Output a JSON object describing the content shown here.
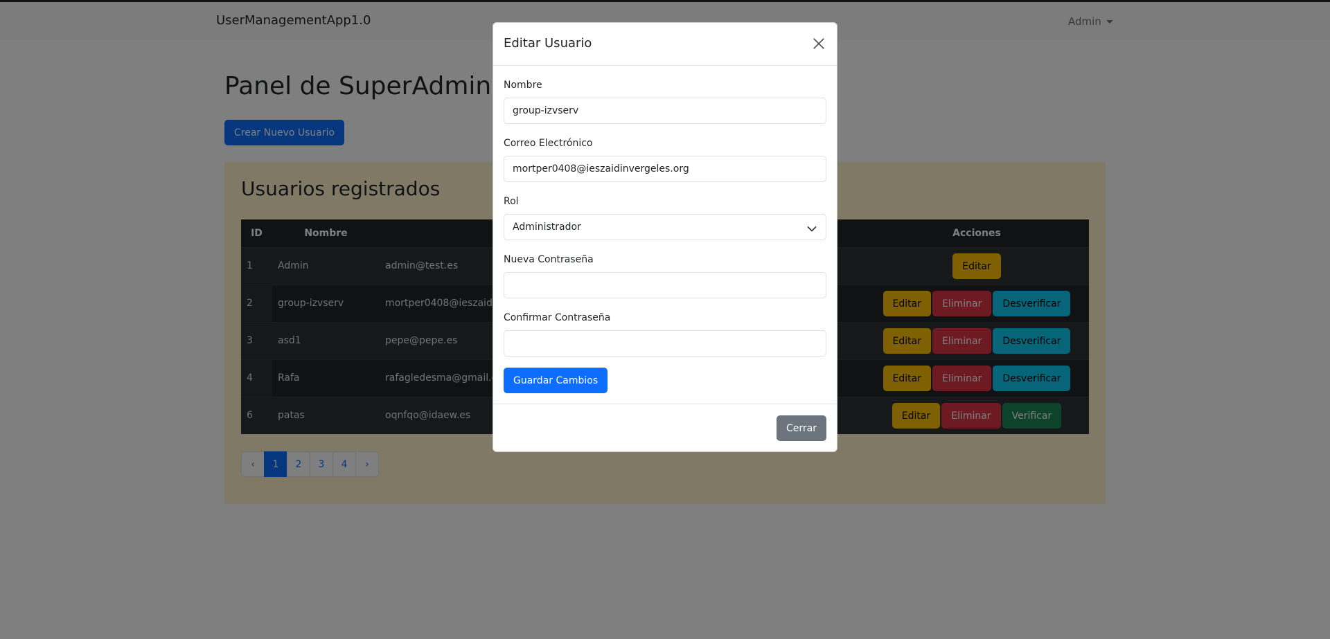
{
  "navbar": {
    "brand": "UserManagementApp1.0",
    "user_menu": "Admin"
  },
  "main": {
    "title": "Panel de SuperAdmin",
    "create_button": "Crear Nuevo Usuario",
    "card_title": "Usuarios registrados",
    "table": {
      "headers": {
        "id": "ID",
        "name": "Nombre",
        "email": "",
        "actions": "Acciones"
      },
      "rows": [
        {
          "id": "1",
          "name": "Admin",
          "email": "admin@test.es",
          "actions": [
            "Editar"
          ]
        },
        {
          "id": "2",
          "name": "group-izvserv",
          "email": "mortper0408@ieszaidin",
          "actions": [
            "Editar",
            "Eliminar",
            "Desverificar"
          ]
        },
        {
          "id": "3",
          "name": "asd1",
          "email": "pepe@pepe.es",
          "actions": [
            "Editar",
            "Eliminar",
            "Desverificar"
          ]
        },
        {
          "id": "4",
          "name": "Rafa",
          "email": "rafagledesma@gmail.co",
          "actions": [
            "Editar",
            "Eliminar",
            "Desverificar"
          ]
        },
        {
          "id": "6",
          "name": "patas",
          "email": "oqnfqo@idaew.es",
          "actions": [
            "Editar",
            "Eliminar",
            "Verificar"
          ]
        }
      ]
    },
    "pagination": {
      "prev": "‹",
      "pages": [
        "1",
        "2",
        "3",
        "4"
      ],
      "next": "›",
      "current": "1"
    }
  },
  "modal": {
    "title": "Editar Usuario",
    "fields": {
      "name": {
        "label": "Nombre",
        "value": "group-izvserv"
      },
      "email": {
        "label": "Correo Electrónico",
        "value": "mortper0408@ieszaidinvergeles.org"
      },
      "role": {
        "label": "Rol",
        "value": "Administrador"
      },
      "new_password": {
        "label": "Nueva Contraseña",
        "value": ""
      },
      "confirm_password": {
        "label": "Confirmar Contraseña",
        "value": ""
      }
    },
    "save_button": "Guardar Cambios",
    "close_button": "Cerrar"
  },
  "colors": {
    "primary": "#0d6efd",
    "warning": "#ffc107",
    "danger": "#dc3545",
    "info": "#0dcaf0",
    "success": "#198754",
    "secondary": "#6c757d",
    "card_bg": "#fff3cd"
  },
  "icons": {
    "close": "close-icon",
    "select": "chevron-down-icon",
    "user_menu": "caret-down-icon"
  }
}
